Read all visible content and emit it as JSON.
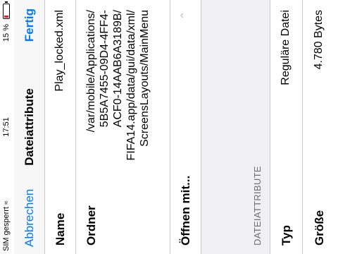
{
  "status_bar": {
    "carrier": "SIM gesperrt",
    "wifi_icon": "wifi-icon",
    "time": "17:51",
    "battery_percent": "15 %",
    "battery_level": 0.15,
    "battery_color": "#e0202a"
  },
  "navbar": {
    "cancel_label": "Abbrechen",
    "title": "Dateiattribute",
    "done_label": "Fertig"
  },
  "rows": {
    "name": {
      "label": "Name",
      "value": "Play_locked.xml"
    },
    "folder": {
      "label": "Ordner",
      "value_lines": [
        "/var/mobile/Applications/",
        "5B5A7455-09D4-4FF4-",
        "ACF0-14AAB6A3189B/",
        "FIFA14.app/data/gui/data/xml/",
        "ScreensLayouts/MainMenu"
      ]
    },
    "open_with": {
      "label": "Öffnen mit...",
      "chevron_icon": "chevron-up-icon"
    }
  },
  "section": {
    "header": "DATEIATTRIBUTE"
  },
  "attributes": {
    "type": {
      "label": "Typ",
      "value": "Reguläre Datei"
    },
    "size": {
      "label": "Größe",
      "value": "4.780 Bytes"
    }
  },
  "colors": {
    "accent": "#007aff",
    "separator": "#c8c7cc",
    "section_bg": "#efeff4"
  }
}
